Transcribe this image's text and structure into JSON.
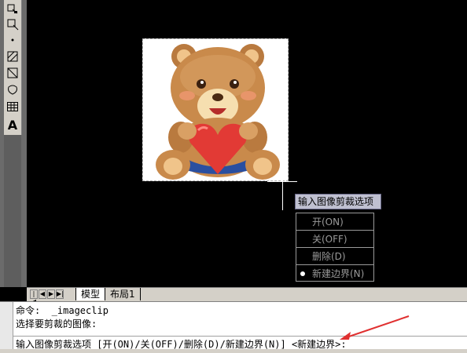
{
  "toolbar": {
    "tools": [
      "insert-block-icon",
      "make-block-icon",
      "point-icon",
      "hatch-icon",
      "gradient-icon",
      "region-icon",
      "table-icon",
      "multiline-text-icon"
    ],
    "text_tool_glyph": "A"
  },
  "image": {
    "name": "teddy-bear-image"
  },
  "prompt_tip": "输入图像剪裁选项",
  "context_menu": {
    "items": [
      {
        "label": "开(ON)"
      },
      {
        "label": "关(OFF)"
      },
      {
        "label": "删除(D)"
      },
      {
        "label": "新建边界(N)",
        "selected": true
      }
    ]
  },
  "layout_tabs": {
    "tabs": [
      "模型",
      "布局1"
    ],
    "active": "模型"
  },
  "command": {
    "line1": "命令:  _imageclip",
    "line2": "选择要剪裁的图像:",
    "line3": "输入图像剪裁选项 [开(ON)/关(OFF)/删除(D)/新建边界(N)] <新建边界>:"
  },
  "colors": {
    "canvas": "#000000",
    "arrow": "#e03030",
    "tip_bg": "#bfc0d0"
  }
}
